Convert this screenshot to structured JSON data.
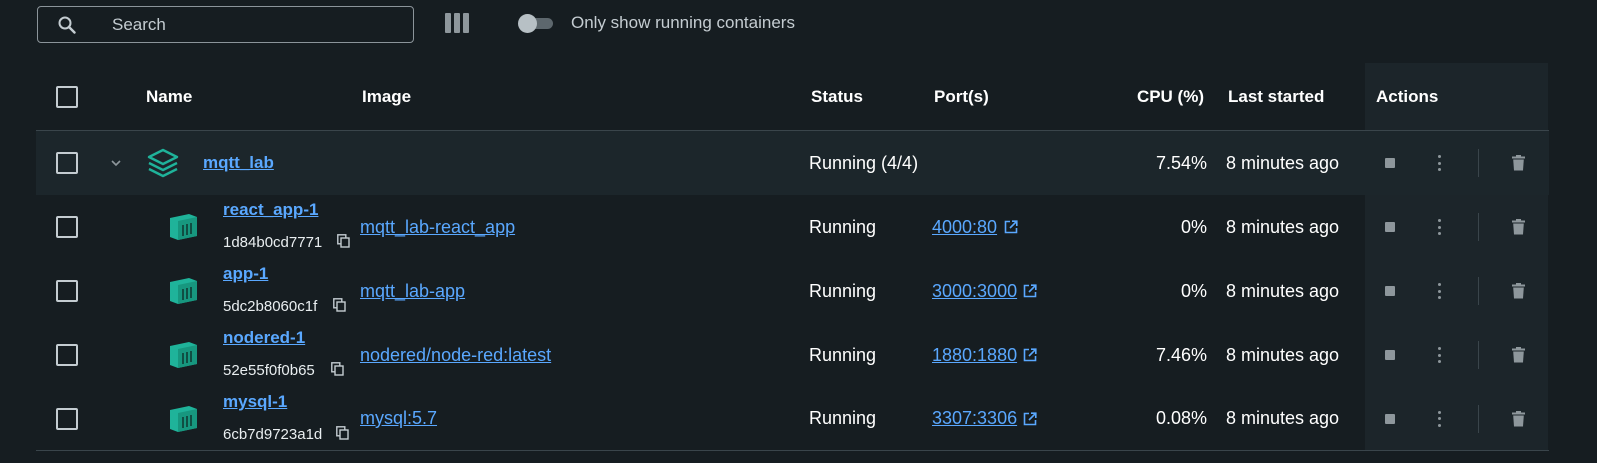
{
  "search": {
    "placeholder": "Search"
  },
  "filter": {
    "label": "Only show running containers"
  },
  "table": {
    "headers": {
      "name": "Name",
      "image": "Image",
      "status": "Status",
      "ports": "Port(s)",
      "cpu": "CPU (%)",
      "last_started": "Last started",
      "actions": "Actions"
    },
    "group": {
      "name": "mqtt_lab",
      "status": "Running (4/4)",
      "cpu": "7.54%",
      "last_started": "8 minutes ago"
    },
    "rows": [
      {
        "name": "react_app-1",
        "id": "1d84b0cd7771",
        "image": "mqtt_lab-react_app",
        "status": "Running",
        "port": "4000:80",
        "cpu": "0%",
        "last_started": "8 minutes ago"
      },
      {
        "name": "app-1",
        "id": "5dc2b8060c1f",
        "image": "mqtt_lab-app",
        "status": "Running",
        "port": "3000:3000",
        "cpu": "0%",
        "last_started": "8 minutes ago"
      },
      {
        "name": "nodered-1",
        "id": "52e55f0f0b65",
        "image": "nodered/node-red:latest",
        "status": "Running",
        "port": "1880:1880",
        "cpu": "7.46%",
        "last_started": "8 minutes ago"
      },
      {
        "name": "mysql-1",
        "id": "6cb7d9723a1d",
        "image": "mysql:5.7",
        "status": "Running",
        "port": "3307:3306",
        "cpu": "0.08%",
        "last_started": "8 minutes ago"
      }
    ]
  },
  "colors": {
    "accent": "#5aa8ff",
    "container_icon": "#1fb39a",
    "background": "#161d21"
  }
}
